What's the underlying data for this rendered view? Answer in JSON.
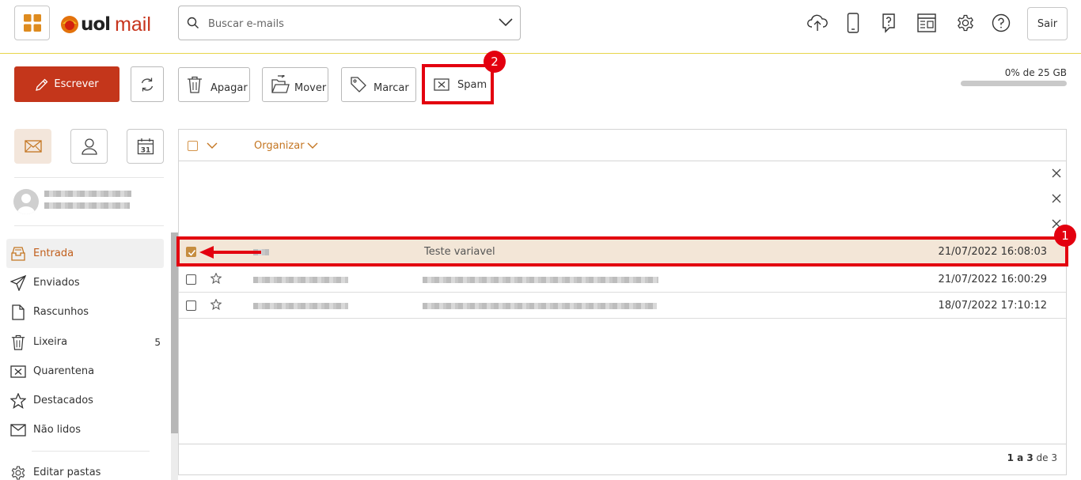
{
  "app": {
    "logo_brand": "uol",
    "logo_product": "mail"
  },
  "search": {
    "placeholder": "Buscar e-mails"
  },
  "header": {
    "icons": [
      "upload-cloud-icon",
      "mobile-phone-icon",
      "help-chat-icon",
      "newsletter-icon",
      "gear-icon",
      "help-circle-icon"
    ],
    "logout_label": "Sair"
  },
  "toolbar": {
    "compose_label": "Escrever",
    "delete_label": "Apagar",
    "move_label": "Mover",
    "mark_label": "Marcar",
    "spam_label": "Spam"
  },
  "storage": {
    "label": "0% de 25 GB",
    "used_fraction": 0.0
  },
  "annotations": {
    "badge_1": "1",
    "badge_2": "2"
  },
  "sidebar": {
    "folders": [
      {
        "label": "Entrada",
        "count": "",
        "icon": "inbox-icon",
        "active": true
      },
      {
        "label": "Enviados",
        "count": "",
        "icon": "send-icon",
        "active": false
      },
      {
        "label": "Rascunhos",
        "count": "",
        "icon": "draft-icon",
        "active": false
      },
      {
        "label": "Lixeira",
        "count": "5",
        "icon": "trash-icon",
        "active": false
      },
      {
        "label": "Quarentena",
        "count": "",
        "icon": "quarantine-icon",
        "active": false
      },
      {
        "label": "Destacados",
        "count": "",
        "icon": "star-icon",
        "active": false
      },
      {
        "label": "Não lidos",
        "count": "",
        "icon": "envelope-icon",
        "active": false
      }
    ],
    "edit_folders_label": "Editar pastas"
  },
  "list": {
    "organize_label": "Organizar",
    "rows": [
      {
        "subject": "Teste variavel",
        "date": "21/07/2022 16:08:03",
        "selected": true
      },
      {
        "subject": "",
        "date": "21/07/2022 16:00:29",
        "selected": false
      },
      {
        "subject": "",
        "date": "18/07/2022 17:10:12",
        "selected": false
      }
    ],
    "pagination": {
      "range": "1 a 3",
      "of": "de 3"
    }
  },
  "colors": {
    "brand": "#c4361b",
    "accent": "#c47622",
    "selected_row": "#f3e6d7",
    "annotation": "#e3000f"
  }
}
